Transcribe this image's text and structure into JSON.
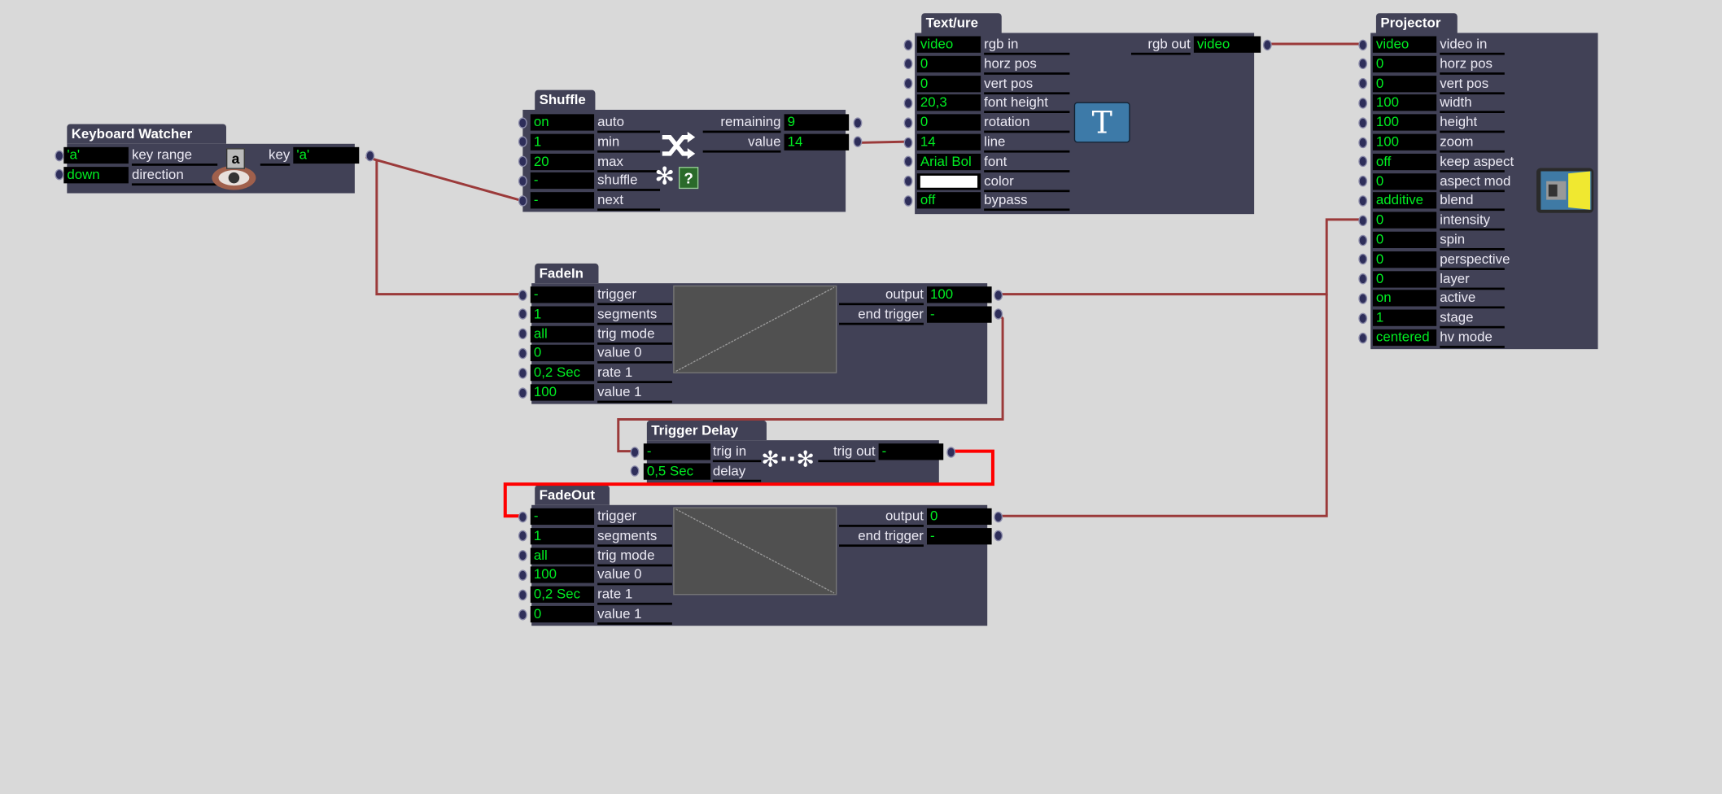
{
  "colors": {
    "background": "#d9d9d9",
    "module": "#414156",
    "field": "#000000",
    "value_text": "#00ee22",
    "wire": "#9b3a3a",
    "wire_selected": "#ff0000"
  },
  "modules": {
    "keyboard": {
      "title": "Keyboard Watcher",
      "icon": "keyboard-eye-icon",
      "icon_key": "a",
      "inputs": [
        {
          "value": "'a'",
          "label": "key range"
        },
        {
          "value": "down",
          "label": "direction"
        }
      ],
      "outputs": [
        {
          "label": "key",
          "value": "'a'"
        }
      ]
    },
    "shuffle": {
      "title": "Shuffle",
      "icon": "shuffle-icon",
      "inputs": [
        {
          "value": "on",
          "label": "auto"
        },
        {
          "value": "1",
          "label": "min"
        },
        {
          "value": "20",
          "label": "max"
        },
        {
          "value": "-",
          "label": "shuffle"
        },
        {
          "value": "-",
          "label": "next"
        }
      ],
      "outputs": [
        {
          "label": "remaining",
          "value": "9"
        },
        {
          "label": "value",
          "value": "14"
        }
      ],
      "help": "?"
    },
    "texture": {
      "title": "Text/ure",
      "icon": "text-t-icon",
      "icon_letter": "T",
      "inputs": [
        {
          "value": "video",
          "label": "rgb in"
        },
        {
          "value": "0",
          "label": "horz pos"
        },
        {
          "value": "0",
          "label": "vert pos"
        },
        {
          "value": "20,3",
          "label": "font height"
        },
        {
          "value": "0",
          "label": "rotation"
        },
        {
          "value": "14",
          "label": "line"
        },
        {
          "value": "Arial Bol",
          "label": "font"
        },
        {
          "value": "",
          "label": "color",
          "swatch": "#ffffff"
        },
        {
          "value": "off",
          "label": "bypass"
        }
      ],
      "outputs": [
        {
          "label": "rgb out",
          "value": "video"
        }
      ]
    },
    "projector": {
      "title": "Projector",
      "icon": "projector-icon",
      "inputs": [
        {
          "value": "video",
          "label": "video in"
        },
        {
          "value": "0",
          "label": "horz pos"
        },
        {
          "value": "0",
          "label": "vert pos"
        },
        {
          "value": "100",
          "label": "width"
        },
        {
          "value": "100",
          "label": "height"
        },
        {
          "value": "100",
          "label": "zoom"
        },
        {
          "value": "off",
          "label": "keep aspect"
        },
        {
          "value": "0",
          "label": "aspect mod"
        },
        {
          "value": "additive",
          "label": "blend"
        },
        {
          "value": "0",
          "label": "intensity"
        },
        {
          "value": "0",
          "label": "spin"
        },
        {
          "value": "0",
          "label": "perspective"
        },
        {
          "value": "0",
          "label": "layer"
        },
        {
          "value": "on",
          "label": "active"
        },
        {
          "value": "1",
          "label": "stage"
        },
        {
          "value": "centered",
          "label": "hv mode"
        }
      ],
      "outputs": []
    },
    "fadein": {
      "title": "FadeIn",
      "curve": "rising",
      "inputs": [
        {
          "value": "-",
          "label": "trigger"
        },
        {
          "value": "1",
          "label": "segments"
        },
        {
          "value": "all",
          "label": "trig mode"
        },
        {
          "value": "0",
          "label": "value 0"
        },
        {
          "value": "0,2 Sec",
          "label": "rate 1"
        },
        {
          "value": "100",
          "label": "value 1"
        }
      ],
      "outputs": [
        {
          "label": "output",
          "value": "100"
        },
        {
          "label": "end trigger",
          "value": "-"
        }
      ]
    },
    "delay": {
      "title": "Trigger Delay",
      "icon": "delay-icon",
      "inputs": [
        {
          "value": "-",
          "label": "trig in"
        },
        {
          "value": "0,5 Sec",
          "label": "delay"
        }
      ],
      "outputs": [
        {
          "label": "trig out",
          "value": "-"
        }
      ]
    },
    "fadeout": {
      "title": "FadeOut",
      "curve": "falling",
      "inputs": [
        {
          "value": "-",
          "label": "trigger"
        },
        {
          "value": "1",
          "label": "segments"
        },
        {
          "value": "all",
          "label": "trig mode"
        },
        {
          "value": "100",
          "label": "value 0"
        },
        {
          "value": "0,2 Sec",
          "label": "rate 1"
        },
        {
          "value": "0",
          "label": "value 1"
        }
      ],
      "outputs": [
        {
          "label": "output",
          "value": "0"
        },
        {
          "label": "end trigger",
          "value": "-"
        }
      ]
    }
  },
  "connections": [
    {
      "from": "keyboard.key",
      "to": "shuffle.next"
    },
    {
      "from": "keyboard.key",
      "to": "fadein.trigger"
    },
    {
      "from": "shuffle.value",
      "to": "texture.line"
    },
    {
      "from": "texture.rgb out",
      "to": "projector.video in"
    },
    {
      "from": "fadein.output",
      "to": "projector.intensity"
    },
    {
      "from": "fadeout.output",
      "to": "projector.intensity"
    },
    {
      "from": "fadein.end trigger",
      "to": "delay.trig in"
    },
    {
      "from": "delay.trig out",
      "to": "fadeout.trigger",
      "selected": true
    }
  ]
}
